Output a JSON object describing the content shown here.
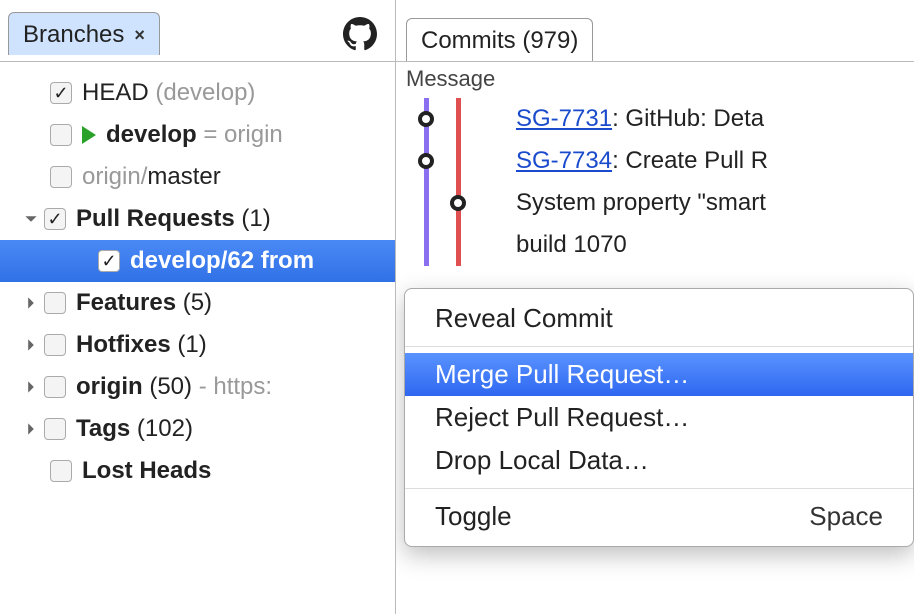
{
  "leftTab": {
    "title": "Branches"
  },
  "tree": {
    "head": {
      "label": "HEAD",
      "note": "(develop)"
    },
    "develop": {
      "label": "develop",
      "note": "= origin"
    },
    "originMaster": {
      "prefix": "origin/",
      "label": "master"
    },
    "pullRequests": {
      "label": "Pull Requests",
      "count": "(1)"
    },
    "prItem": {
      "label": "develop/62 from"
    },
    "features": {
      "label": "Features",
      "count": "(5)"
    },
    "hotfixes": {
      "label": "Hotfixes",
      "count": "(1)"
    },
    "origin": {
      "label": "origin",
      "count": "(50)",
      "note": "- https:"
    },
    "tags": {
      "label": "Tags",
      "count": "(102)"
    },
    "lostHeads": {
      "label": "Lost Heads"
    }
  },
  "rightTab": {
    "title": "Commits (979)"
  },
  "messageHeader": "Message",
  "commits": [
    {
      "link": "SG-7731",
      "msg": ": GitHub: Deta"
    },
    {
      "link": "SG-7734",
      "msg": ": Create Pull R"
    },
    {
      "link": "",
      "msg": "System property \"smart"
    },
    {
      "link": "",
      "msg": "build 1070"
    }
  ],
  "menu": {
    "reveal": "Reveal Commit",
    "merge": "Merge Pull Request…",
    "reject": "Reject Pull Request…",
    "drop": "Drop Local Data…",
    "toggle": "Toggle",
    "toggleShortcut": "Space"
  },
  "colors": {
    "graph1": "#8a6ff0",
    "graph2": "#e05050"
  }
}
